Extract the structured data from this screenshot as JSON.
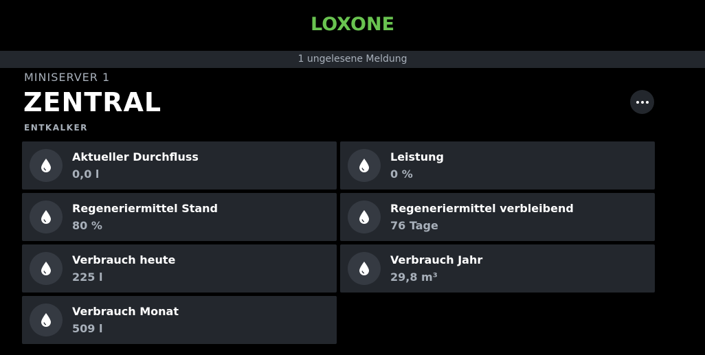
{
  "header": {
    "logo": "LOXONE",
    "notice": "1 ungelesene Meldung"
  },
  "room": {
    "server": "MINISERVER 1",
    "title": "ZENTRAL",
    "subtitle": "ENTKALKER"
  },
  "tiles": [
    {
      "label": "Aktueller Durchfluss",
      "value": "0,0 l",
      "icon": "water-drop-icon"
    },
    {
      "label": "Leistung",
      "value": "0 %",
      "icon": "water-drop-icon"
    },
    {
      "label": "Regeneriermittel Stand",
      "value": "80 %",
      "icon": "water-drop-icon"
    },
    {
      "label": "Regeneriermittel verbleibend",
      "value": "76 Tage",
      "icon": "water-drop-icon"
    },
    {
      "label": "Verbrauch heute",
      "value": "225 l",
      "icon": "water-drop-icon"
    },
    {
      "label": "Verbrauch Jahr",
      "value": "29,8 m³",
      "icon": "water-drop-icon"
    },
    {
      "label": "Verbrauch Monat",
      "value": "509 l",
      "icon": "water-drop-icon"
    }
  ],
  "colors": {
    "brand": "#69c350",
    "background": "#000000",
    "card": "#23272d",
    "icon_circle": "#353a42",
    "muted_text": "#a8b0ba"
  }
}
